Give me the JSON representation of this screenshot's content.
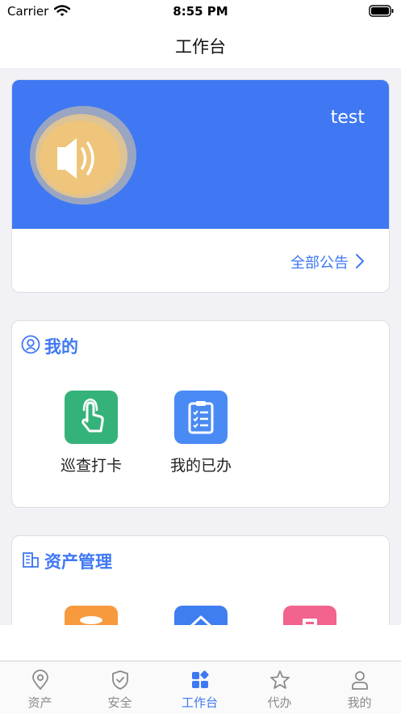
{
  "status_bar": {
    "carrier": "Carrier",
    "time": "8:55 PM"
  },
  "nav": {
    "title": "工作台"
  },
  "banner": {
    "name": "test",
    "notice_link": "全部公告"
  },
  "mine": {
    "title": "我的",
    "apps": [
      {
        "label": "巡查打卡",
        "color": "#34b27a",
        "icon": "hand-tap-icon"
      },
      {
        "label": "我的已办",
        "color": "#4a8af4",
        "icon": "clipboard-list-icon"
      }
    ]
  },
  "assets": {
    "title": "资产管理",
    "apps": [
      {
        "color": "#f79a3e",
        "icon": "database-icon"
      },
      {
        "color": "#3f7ef0",
        "icon": "home-icon"
      },
      {
        "color": "#f2638e",
        "icon": "document-icon"
      }
    ]
  },
  "tabs": [
    {
      "label": "资产",
      "icon": "map-pin-icon"
    },
    {
      "label": "安全",
      "icon": "shield-check-icon"
    },
    {
      "label": "工作台",
      "icon": "grid-icon",
      "active": true
    },
    {
      "label": "代办",
      "icon": "star-icon"
    },
    {
      "label": "我的",
      "icon": "person-icon"
    }
  ],
  "colors": {
    "accent": "#3f78f2",
    "background": "#f2f2f6"
  }
}
